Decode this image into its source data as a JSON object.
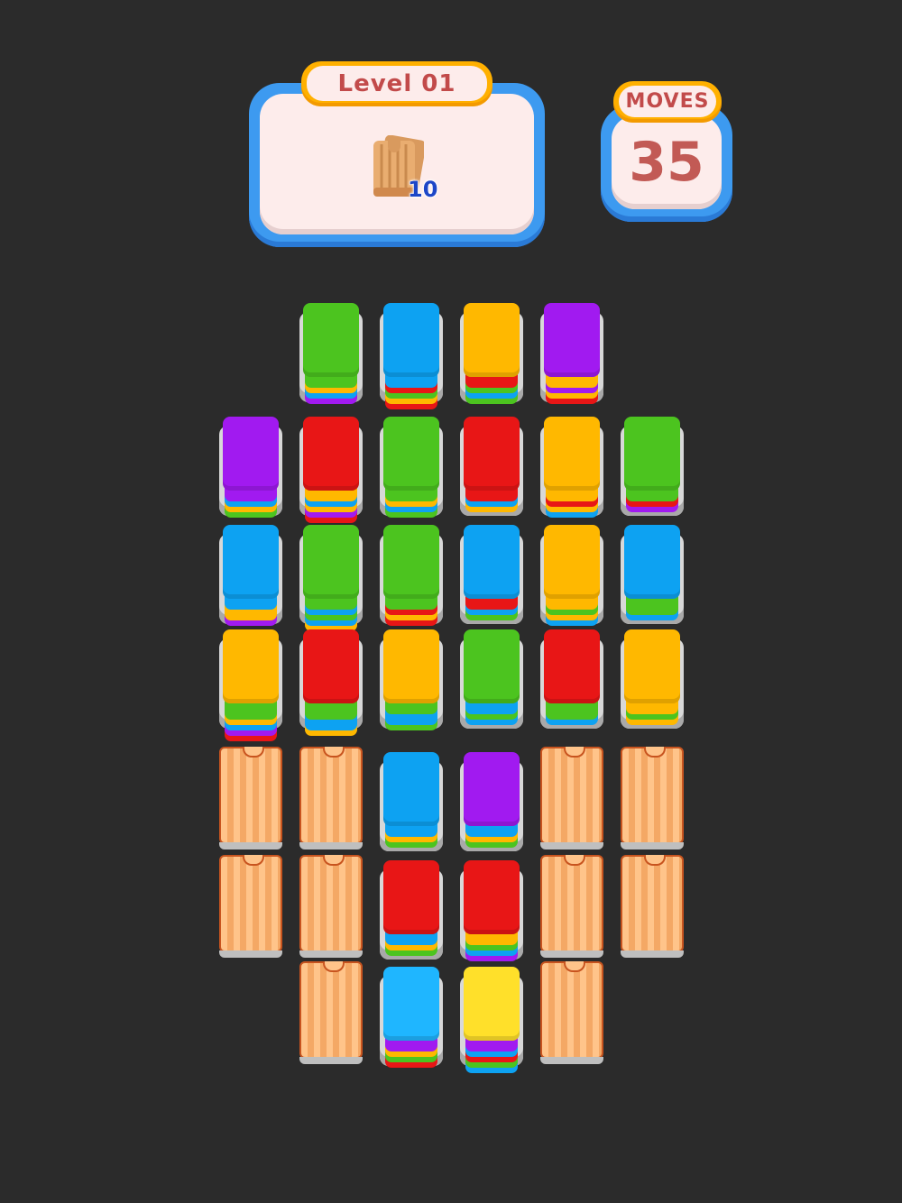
{
  "level": {
    "label": "Level 01"
  },
  "goal": {
    "count": "10",
    "icon": "wood-crate-icon"
  },
  "moves": {
    "label": "MOVES",
    "value": "35"
  },
  "colors": {
    "green": "#4cc41f",
    "blue": "#0da2f2",
    "yellow": "#ffb800",
    "purple": "#a11af0",
    "red": "#e81616",
    "brightblue": "#1fb6ff",
    "lemon": "#ffe02a",
    "crate": "#f4a865",
    "hud_blue": "#3d9af0"
  },
  "board": {
    "cells": [
      {
        "name": "r0c1",
        "type": "stack",
        "top": "green",
        "layers": [
          "purple",
          "blue",
          "yellow",
          "green"
        ]
      },
      {
        "name": "r0c2",
        "type": "stack",
        "top": "blue",
        "layers": [
          "red",
          "yellow",
          "green",
          "red",
          "blue"
        ]
      },
      {
        "name": "r0c3",
        "type": "stack",
        "top": "yellow",
        "layers": [
          "green",
          "blue",
          "green",
          "red"
        ]
      },
      {
        "name": "r0c4",
        "type": "stack",
        "top": "purple",
        "layers": [
          "red",
          "yellow",
          "purple",
          "yellow"
        ]
      },
      {
        "name": "r1c0",
        "type": "stack",
        "top": "purple",
        "layers": [
          "green",
          "yellow",
          "blue",
          "purple"
        ]
      },
      {
        "name": "r1c1",
        "type": "stack",
        "top": "red",
        "layers": [
          "red",
          "purple",
          "yellow",
          "blue",
          "yellow"
        ]
      },
      {
        "name": "r1c2",
        "type": "stack",
        "top": "green",
        "layers": [
          "green",
          "blue",
          "yellow",
          "green"
        ]
      },
      {
        "name": "r1c3",
        "type": "stack",
        "top": "red",
        "layers": [
          "yellow",
          "blue",
          "red"
        ]
      },
      {
        "name": "r1c4",
        "type": "stack",
        "top": "yellow",
        "layers": [
          "blue",
          "yellow",
          "red",
          "yellow"
        ]
      },
      {
        "name": "r1c5",
        "type": "stack",
        "top": "green",
        "layers": [
          "purple",
          "red",
          "green"
        ]
      },
      {
        "name": "r2c0",
        "type": "stack",
        "top": "blue",
        "layers": [
          "purple",
          "yellow",
          "yellow",
          "blue"
        ]
      },
      {
        "name": "r2c1",
        "type": "stack",
        "top": "green",
        "layers": [
          "yellow",
          "blue",
          "green",
          "blue",
          "green"
        ]
      },
      {
        "name": "r2c2",
        "type": "stack",
        "top": "green",
        "layers": [
          "red",
          "yellow",
          "red",
          "green"
        ]
      },
      {
        "name": "r2c3",
        "type": "stack",
        "top": "blue",
        "layers": [
          "green",
          "blue",
          "red"
        ]
      },
      {
        "name": "r2c4",
        "type": "stack",
        "top": "yellow",
        "layers": [
          "blue",
          "yellow",
          "green",
          "yellow"
        ]
      },
      {
        "name": "r2c5",
        "type": "stack",
        "top": "blue",
        "layers": [
          "blue",
          "green",
          "green"
        ]
      },
      {
        "name": "r3c0",
        "type": "stack",
        "top": "yellow",
        "layers": [
          "red",
          "purple",
          "blue",
          "yellow",
          "green",
          "green"
        ]
      },
      {
        "name": "r3c1",
        "type": "stack",
        "top": "red",
        "layers": [
          "yellow",
          "blue",
          "blue",
          "green",
          "green"
        ]
      },
      {
        "name": "r3c2",
        "type": "stack",
        "top": "yellow",
        "layers": [
          "green",
          "blue",
          "blue",
          "green"
        ]
      },
      {
        "name": "r3c3",
        "type": "stack",
        "top": "green",
        "layers": [
          "blue",
          "green",
          "blue"
        ]
      },
      {
        "name": "r3c4",
        "type": "stack",
        "top": "red",
        "layers": [
          "blue",
          "green",
          "green"
        ]
      },
      {
        "name": "r3c5",
        "type": "stack",
        "top": "yellow",
        "layers": [
          "yellow",
          "green",
          "yellow"
        ]
      },
      {
        "name": "r4c0",
        "type": "crate"
      },
      {
        "name": "r4c1",
        "type": "crate"
      },
      {
        "name": "r4c2",
        "type": "stack",
        "top": "blue",
        "layers": [
          "green",
          "yellow",
          "blue"
        ]
      },
      {
        "name": "r4c3",
        "type": "stack",
        "top": "purple",
        "layers": [
          "green",
          "yellow",
          "blue"
        ]
      },
      {
        "name": "r4c4",
        "type": "crate"
      },
      {
        "name": "r4c5",
        "type": "crate"
      },
      {
        "name": "r5c0",
        "type": "crate"
      },
      {
        "name": "r5c1",
        "type": "crate"
      },
      {
        "name": "r5c2",
        "type": "stack",
        "top": "red",
        "layers": [
          "green",
          "yellow",
          "blue"
        ]
      },
      {
        "name": "r5c3",
        "type": "stack",
        "top": "red",
        "layers": [
          "purple",
          "blue",
          "green",
          "yellow"
        ]
      },
      {
        "name": "r5c4",
        "type": "crate"
      },
      {
        "name": "r5c5",
        "type": "crate"
      },
      {
        "name": "r6c1",
        "type": "crate"
      },
      {
        "name": "r6c2",
        "type": "stack",
        "top": "brightblue",
        "layers": [
          "red",
          "green",
          "yellow",
          "purple"
        ]
      },
      {
        "name": "r6c3",
        "type": "stack",
        "top": "lemon",
        "layers": [
          "blue",
          "green",
          "red",
          "blue",
          "purple"
        ]
      },
      {
        "name": "r6c4",
        "type": "crate"
      }
    ]
  }
}
